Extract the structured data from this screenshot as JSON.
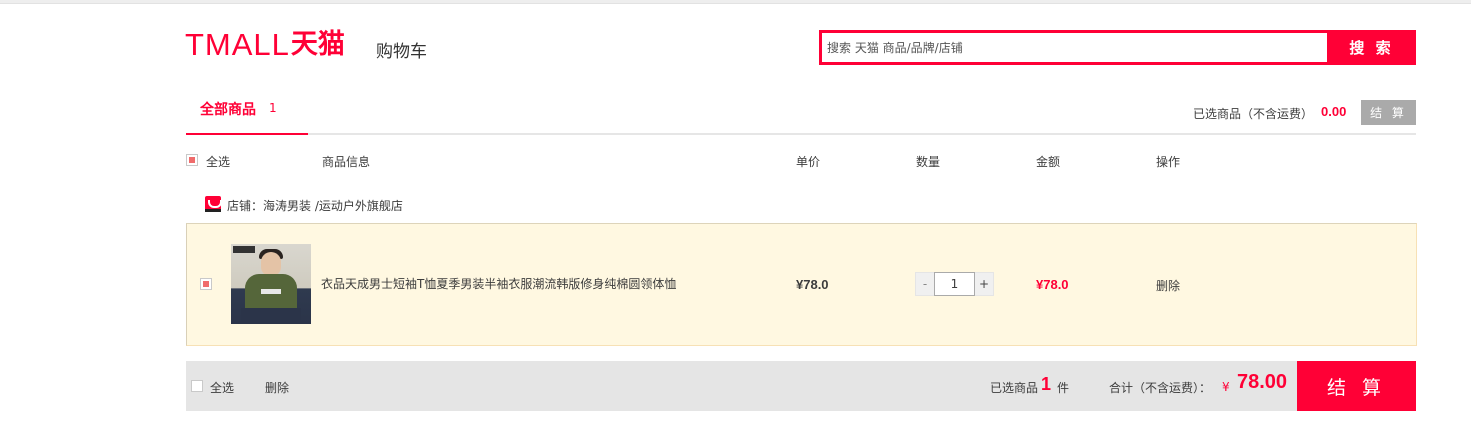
{
  "header": {
    "logo_en": "TMALL",
    "logo_cn": "天猫",
    "page_title": "购物车",
    "search": {
      "placeholder": "搜索 天猫 商品/品牌/店铺",
      "value": "",
      "button": "搜 索"
    }
  },
  "tabs": [
    {
      "label": "全部商品",
      "count": "1",
      "active": true
    }
  ],
  "summary_top": {
    "label": "已选商品（不含运费）",
    "total": "0.00",
    "checkout": "结 算"
  },
  "columns": {
    "select_all": "全选",
    "info": "商品信息",
    "price": "单价",
    "qty": "数量",
    "amount": "金额",
    "actions": "操作"
  },
  "shop": {
    "label": "店铺：",
    "name": "海涛男装 /运动户外旗舰店",
    "icon": "tmall-shop-icon"
  },
  "items": [
    {
      "checked": true,
      "title": "衣品天成男士短袖T恤夏季男装半袖衣服潮流韩版修身纯棉圆领体恤",
      "price": "¥78.0",
      "quantity": "1",
      "amount": "¥78.0",
      "delete": "删除"
    }
  ],
  "bottom": {
    "select_all": "全选",
    "delete": "删除",
    "selected_prefix": "已选商品",
    "selected_count": "1",
    "selected_suffix": "件",
    "total_label": "合计（不含运费）：",
    "currency": "¥",
    "total": "78.00",
    "checkout": "结 算"
  },
  "colors": {
    "accent": "#ff0036",
    "item_bg": "#fff8e1",
    "bar_bg": "#e5e5e5",
    "disabled_btn": "#aaaaaa"
  }
}
